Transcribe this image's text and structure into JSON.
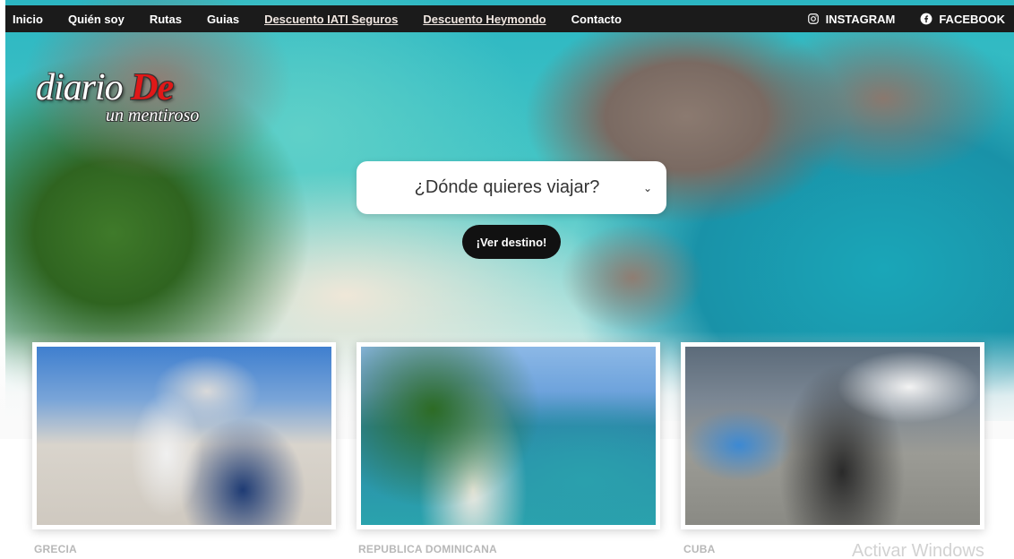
{
  "nav": {
    "items": [
      {
        "label": "Inicio"
      },
      {
        "label": "Quién soy"
      },
      {
        "label": "Rutas"
      },
      {
        "label": "Guias"
      },
      {
        "label": "Descuento IATI Seguros"
      },
      {
        "label": "Descuento Heymondo"
      },
      {
        "label": "Contacto"
      }
    ],
    "social": {
      "instagram": {
        "label": "INSTAGRAM",
        "icon": "instagram-icon"
      },
      "facebook": {
        "label": "FACEBOOK",
        "icon": "facebook-icon"
      }
    }
  },
  "logo": {
    "main": "diario ",
    "accent": "De",
    "sub": "un mentiroso"
  },
  "search": {
    "select_value": "¿Dónde quieres viajar?",
    "button_label": "¡Ver destino!"
  },
  "destinations": [
    {
      "label": "GRECIA"
    },
    {
      "label": "REPUBLICA DOMINICANA"
    },
    {
      "label": "CUBA"
    }
  ],
  "overlay": {
    "watermark": "Activar Windows"
  },
  "colors": {
    "nav_bg": "#1b1b1b",
    "logo_accent": "#e01818",
    "cta_bg": "#111111"
  }
}
